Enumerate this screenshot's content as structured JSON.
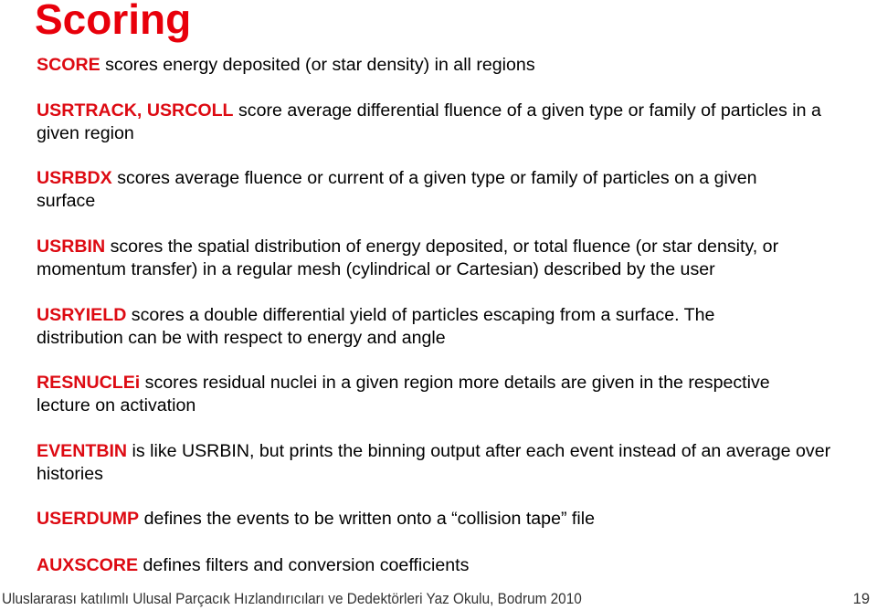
{
  "title": "Scoring",
  "colors": {
    "accent": "#e8000b",
    "text": "#000000"
  },
  "items": [
    {
      "keyword": "SCORE",
      "text": " scores energy deposited (or star density) in all regions"
    },
    {
      "keyword": "USRTRACK, USRCOLL",
      "text": " score average differential fluence of a given type or family of particles in a given region"
    },
    {
      "keyword": "USRBDX",
      "text": " scores average fluence or current of a given type or family of particles on a given surface"
    },
    {
      "keyword": "USRBIN",
      "text": " scores the spatial distribution of energy deposited, or total fluence (or star density, or momentum transfer) in a regular mesh (cylindrical or Cartesian) described by the user"
    },
    {
      "keyword": "USRYIELD",
      "text": " scores a double differential yield of particles escaping from a surface. The distribution can be with respect to energy and angle"
    },
    {
      "keyword": "RESNUCLEi",
      "text": " scores residual nuclei in a given region more details are given in the respective lecture on activation"
    },
    {
      "keyword": "EVENTBIN",
      "text": " is like USRBIN, but prints the binning output after each event instead of an average over histories"
    },
    {
      "keyword": "USERDUMP",
      "text": " defines the events to be written onto a “collision tape” file"
    },
    {
      "keyword": "AUXSCORE",
      "text": " defines filters and conversion coefficients"
    }
  ],
  "footer": {
    "text": "Uluslararası katılımlı Ulusal Parçacık Hızlandırıcıları ve Dedektörleri Yaz Okulu, Bodrum 2010",
    "page": "19"
  }
}
